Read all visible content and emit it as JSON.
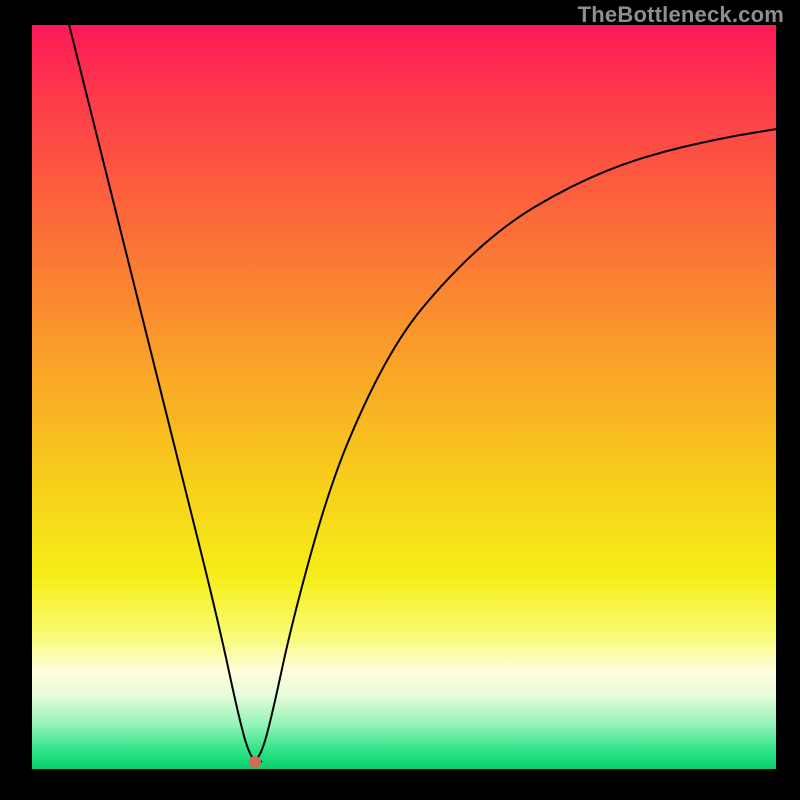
{
  "watermark": "TheBottleneck.com",
  "chart_data": {
    "type": "line",
    "title": "",
    "xlabel": "",
    "ylabel": "",
    "xlim": [
      0,
      100
    ],
    "ylim": [
      0,
      100
    ],
    "grid": false,
    "legend": false,
    "annotations": [
      {
        "kind": "marker",
        "x": 30,
        "y": 1,
        "color": "#d46a56"
      }
    ],
    "series": [
      {
        "name": "left-branch",
        "x": [
          5,
          10,
          15,
          20,
          25,
          28,
          30
        ],
        "y": [
          100,
          80,
          60,
          40,
          20,
          6,
          1
        ]
      },
      {
        "name": "right-branch",
        "x": [
          30,
          32,
          35,
          40,
          45,
          50,
          55,
          60,
          65,
          70,
          75,
          80,
          85,
          90,
          95,
          100
        ],
        "y": [
          1,
          6,
          20,
          38,
          50,
          59,
          65,
          70,
          74,
          77,
          79.5,
          81.5,
          83,
          84.2,
          85.2,
          86
        ]
      }
    ],
    "background_gradient": {
      "direction": "vertical",
      "stops": [
        {
          "pos": 0.0,
          "color": "#fc1958"
        },
        {
          "pos": 0.28,
          "color": "#fb6f38"
        },
        {
          "pos": 0.62,
          "color": "#f7d01a"
        },
        {
          "pos": 0.87,
          "color": "#fffde0"
        },
        {
          "pos": 0.97,
          "color": "#3de58f"
        },
        {
          "pos": 1.0,
          "color": "#0ecb6e"
        }
      ]
    }
  }
}
